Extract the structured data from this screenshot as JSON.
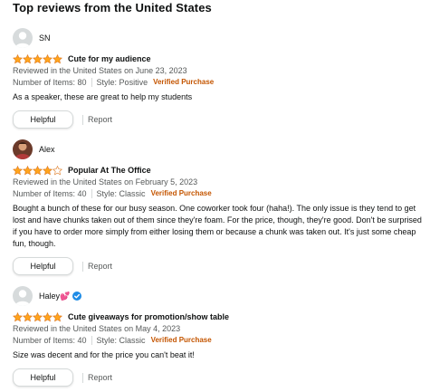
{
  "section_title": "Top reviews from the United States",
  "colors": {
    "star": "#ffa41c",
    "verified": "#c45500",
    "muted_text": "#565959",
    "button_border": "#d5d9d9"
  },
  "reviews": [
    {
      "profile_name": "SN",
      "avatar": "default-avatar",
      "rating": 5,
      "title": "Cute for my audience",
      "date_line": "Reviewed in the United States on June 23, 2023",
      "items": "Number of Items: 80",
      "style": "Style: Positive",
      "verified": "Verified Purchase",
      "body": "As a speaker, these are great to help my students",
      "helpful_label": "Helpful",
      "report_label": "Report"
    },
    {
      "profile_name": "Alex",
      "avatar": "photo-avatar",
      "rating": 4,
      "title": "Popular At The Office",
      "date_line": "Reviewed in the United States on February 5, 2023",
      "items": "Number of Items: 40",
      "style": "Style: Classic",
      "verified": "Verified Purchase",
      "body": "Bought a bunch of these for our busy season. One coworker took four (haha!). The only issue is they tend to get lost and have chunks taken out of them since they're foam. For the price, though, they're good. Don't be surprised if you have to order more simply from either losing them or because a chunk was taken out. It's just some cheap fun, though.",
      "helpful_label": "Helpful",
      "report_label": "Report"
    },
    {
      "profile_name": "Haley💕",
      "avatar": "default-avatar",
      "badge": "verified-check-icon",
      "rating": 5,
      "title": "Cute giveaways for promotion/show table",
      "date_line": "Reviewed in the United States on May 4, 2023",
      "items": "Number of Items: 40",
      "style": "Style: Classic",
      "verified": "Verified Purchase",
      "body": "Size was decent and for the price you can't beat it!",
      "helpful_label": "Helpful",
      "report_label": "Report"
    }
  ]
}
